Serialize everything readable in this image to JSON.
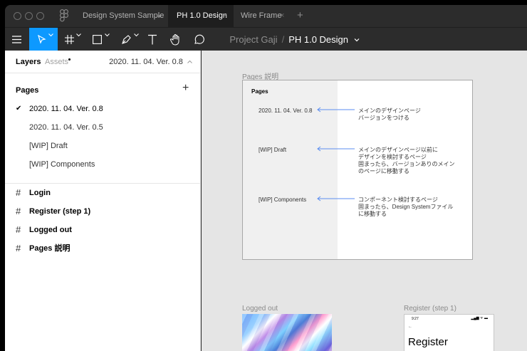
{
  "tabs": [
    {
      "label": "Design System Sample",
      "unsaved_dot": "●"
    },
    {
      "label": "PH 1.0 Design",
      "close": "×"
    },
    {
      "label": "Wire Frame",
      "close": "×"
    }
  ],
  "tab_plus": "+",
  "document": {
    "project": "Project Gaji",
    "separator": "/",
    "page": "PH 1.0 Design",
    "caret": "⌄"
  },
  "left_panel": {
    "tab_layers": "Layers",
    "tab_assets": "Assets",
    "current_page": "2020. 11. 04. Ver. 0.8",
    "pages_header": "Pages",
    "add_page": "+",
    "pages": [
      {
        "label": "2020. 11. 04. Ver. 0.8",
        "check": "✔"
      },
      {
        "label": "2020. 11. 04. Ver. 0.5"
      },
      {
        "label": "[WIP] Draft"
      },
      {
        "label": "[WIP] Components"
      }
    ],
    "frames": [
      {
        "label": "Login"
      },
      {
        "label": "Register (step 1)"
      },
      {
        "label": "Logged out"
      },
      {
        "label": "Pages 説明"
      }
    ],
    "hash": "#"
  },
  "canvas": {
    "pages_frame_label": "Pages 説明",
    "pages_frame": {
      "title": "Pages",
      "rows": [
        {
          "name": "2020. 11. 04. Ver. 0.8",
          "desc": [
            "メインのデザインページ",
            "バージョンをつける"
          ]
        },
        {
          "name": "[WIP] Draft",
          "desc": [
            "メインのデザインページ以前に",
            "デザインを検討するページ",
            "固まったら、バージョンありのメイン",
            "のページに移動する"
          ]
        },
        {
          "name": "[WIP] Components",
          "desc": [
            "コンポーネント検討するページ",
            "固まったら、Design Systemファイル",
            "に移動する"
          ]
        }
      ]
    },
    "logged_out_label": "Logged out",
    "register_label": "Register (step 1)",
    "register": {
      "time": "9:27",
      "status": "▂▄▆ ᯤ ▬",
      "back": "←",
      "title": "Register"
    }
  },
  "colors": {
    "accent": "#0d99ff",
    "arrow": "#5b8ef0"
  }
}
